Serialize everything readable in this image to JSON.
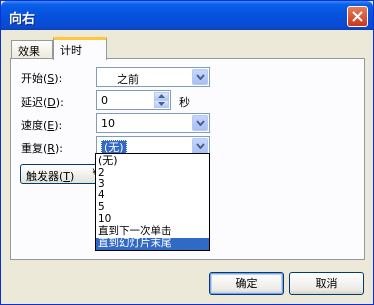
{
  "window": {
    "title": "向右"
  },
  "tabs": [
    {
      "label": "效果"
    },
    {
      "label": "计时"
    }
  ],
  "form": {
    "start": {
      "label": "开始",
      "key": "S",
      "value": "之前"
    },
    "delay": {
      "label": "延迟",
      "key": "D",
      "value": "0",
      "unit": "秒"
    },
    "speed": {
      "label": "速度",
      "key": "E",
      "value": "10"
    },
    "repeat": {
      "label": "重复",
      "key": "R",
      "value": "(无)"
    }
  },
  "trigger": {
    "label": "触发器",
    "key": "T",
    "arrow": "¥"
  },
  "repeat_options": [
    "(无)",
    "2",
    "3",
    "4",
    "5",
    "10",
    "直到下一次单击",
    "直到幻灯片末尾"
  ],
  "buttons": {
    "ok": "确定",
    "cancel": "取消"
  },
  "colors": {
    "title_bar": "#0550dc",
    "selection": "#316ac5",
    "tab_accent": "#ffc83c"
  }
}
